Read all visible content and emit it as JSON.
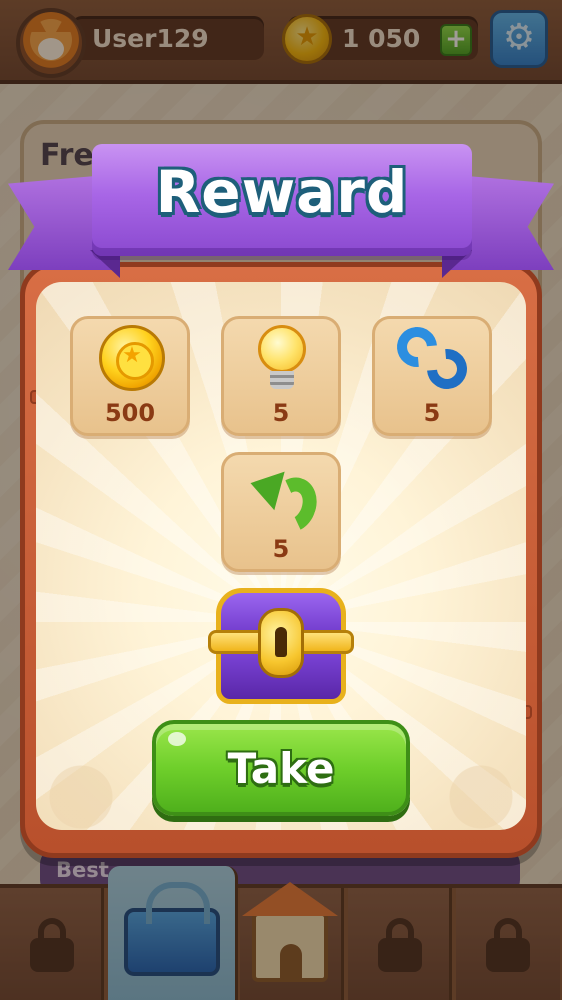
{
  "header": {
    "username": "User129",
    "coins": "1 050",
    "plus_label": "+",
    "settings_icon": "gear-icon"
  },
  "background": {
    "card_title": "Fre",
    "best_label": "Best"
  },
  "modal": {
    "title": "Reward",
    "rewards": [
      {
        "icon": "coin-icon",
        "amount": "500"
      },
      {
        "icon": "lightbulb-hint-icon",
        "amount": "5"
      },
      {
        "icon": "shuffle-icon",
        "amount": "5"
      },
      {
        "icon": "undo-arrow-icon",
        "amount": "5"
      }
    ],
    "chest_icon": "treasure-chest-icon",
    "take_label": "Take"
  },
  "bottom_nav": {
    "items": [
      {
        "icon": "lock-icon",
        "state": "locked"
      },
      {
        "icon": "basket-icon",
        "state": "active"
      },
      {
        "icon": "home-icon",
        "state": "normal"
      },
      {
        "icon": "lock-icon",
        "state": "locked"
      },
      {
        "icon": "lock-icon",
        "state": "locked"
      }
    ]
  },
  "colors": {
    "ribbon": "#a866e6",
    "button": "#6fcf2b",
    "frame": "#c85e38",
    "amount_text": "#8a3a14"
  }
}
